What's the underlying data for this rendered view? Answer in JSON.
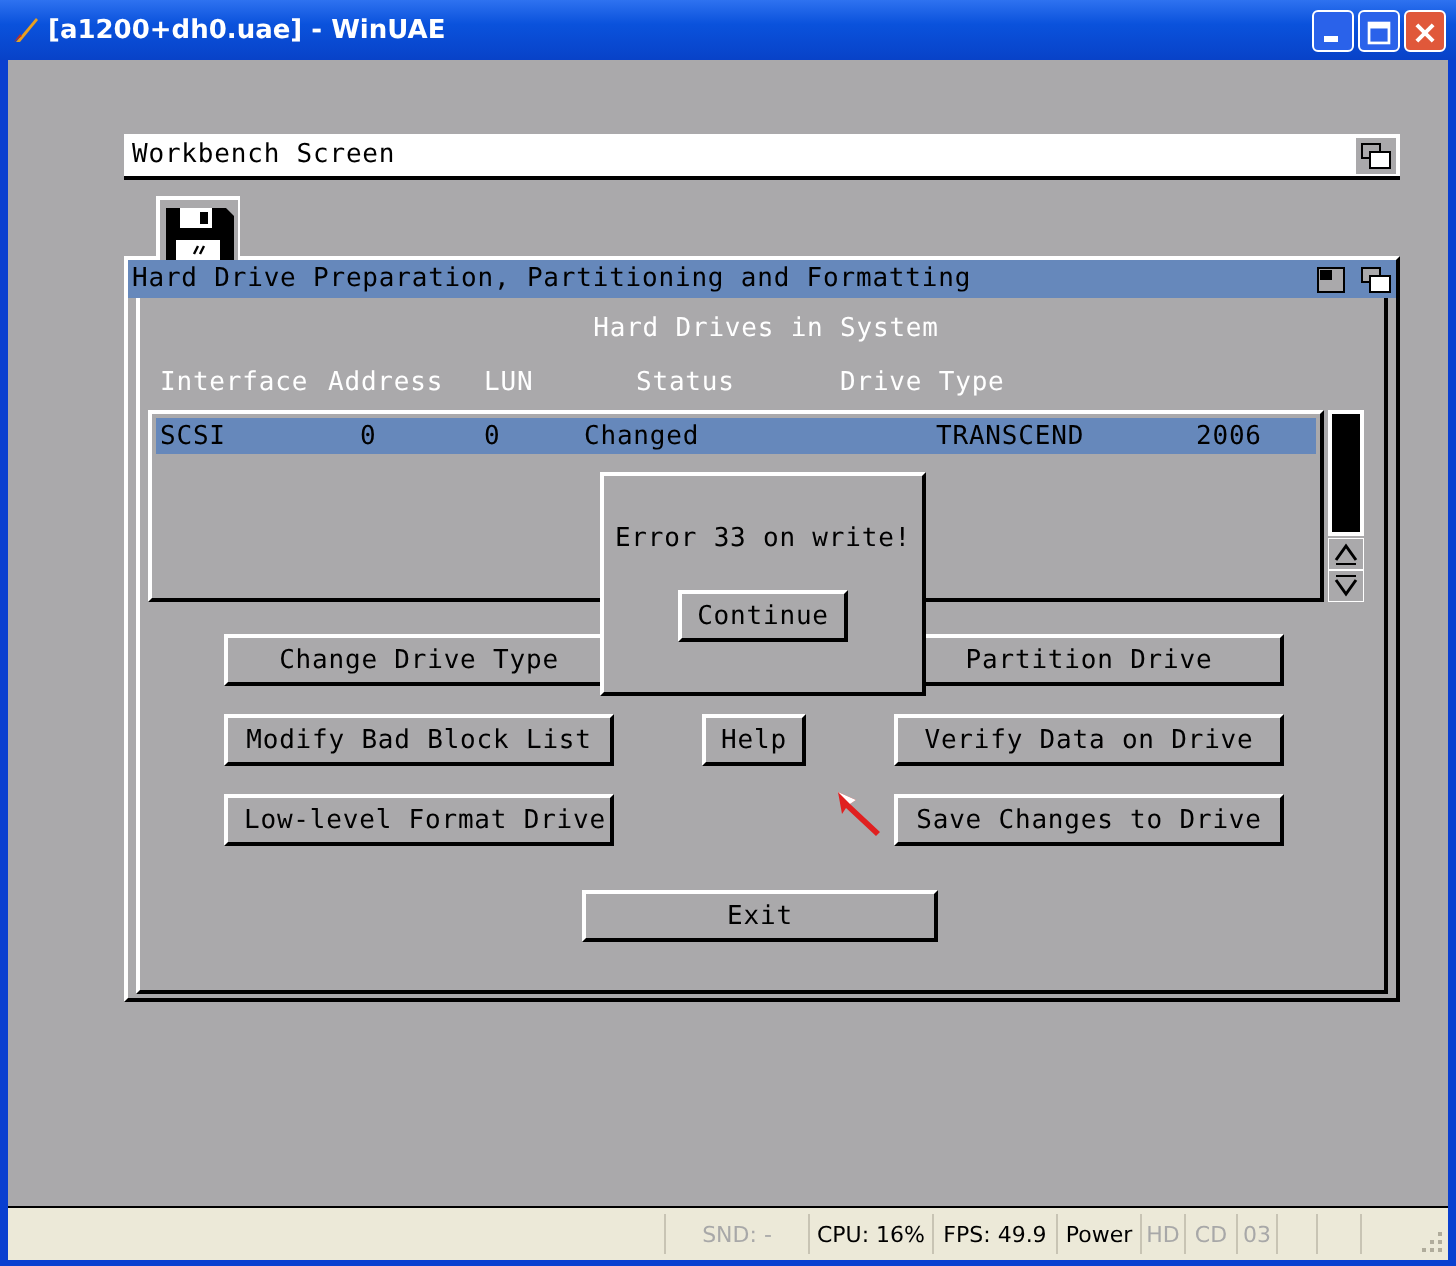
{
  "window": {
    "title": "[a1200+dh0.uae] - WinUAE"
  },
  "screen": {
    "title": "Workbench Screen"
  },
  "hd_window": {
    "title": "Hard Drive Preparation, Partitioning and Formatting",
    "heading": "Hard Drives in System",
    "columns": [
      "Interface",
      "Address",
      "LUN",
      "Status",
      "Drive Type"
    ],
    "rows": [
      {
        "cells": [
          "SCSI",
          "0",
          "0",
          "Changed",
          "TRANSCEND",
          "2006"
        ],
        "selected": true
      }
    ],
    "button_rows": [
      {
        "left": "Change Drive Type",
        "right": "Partition Drive"
      },
      {
        "left": "Modify Bad Block List",
        "center": "Help",
        "right": "Verify Data on Drive"
      },
      {
        "left": "Low-level Format Drive",
        "right": "Save Changes to Drive"
      }
    ],
    "exit": "Exit"
  },
  "dialog": {
    "message": "Error 33 on write!",
    "button": "Continue"
  },
  "status_bar": [
    {
      "text": "SND: -",
      "disabled": true
    },
    {
      "text": "CPU: 16%",
      "disabled": false
    },
    {
      "text": "FPS: 49.9",
      "disabled": false
    },
    {
      "text": "Power",
      "disabled": false
    },
    {
      "text": "HD",
      "disabled": true
    },
    {
      "text": "CD",
      "disabled": true
    },
    {
      "text": "03",
      "disabled": true
    }
  ]
}
